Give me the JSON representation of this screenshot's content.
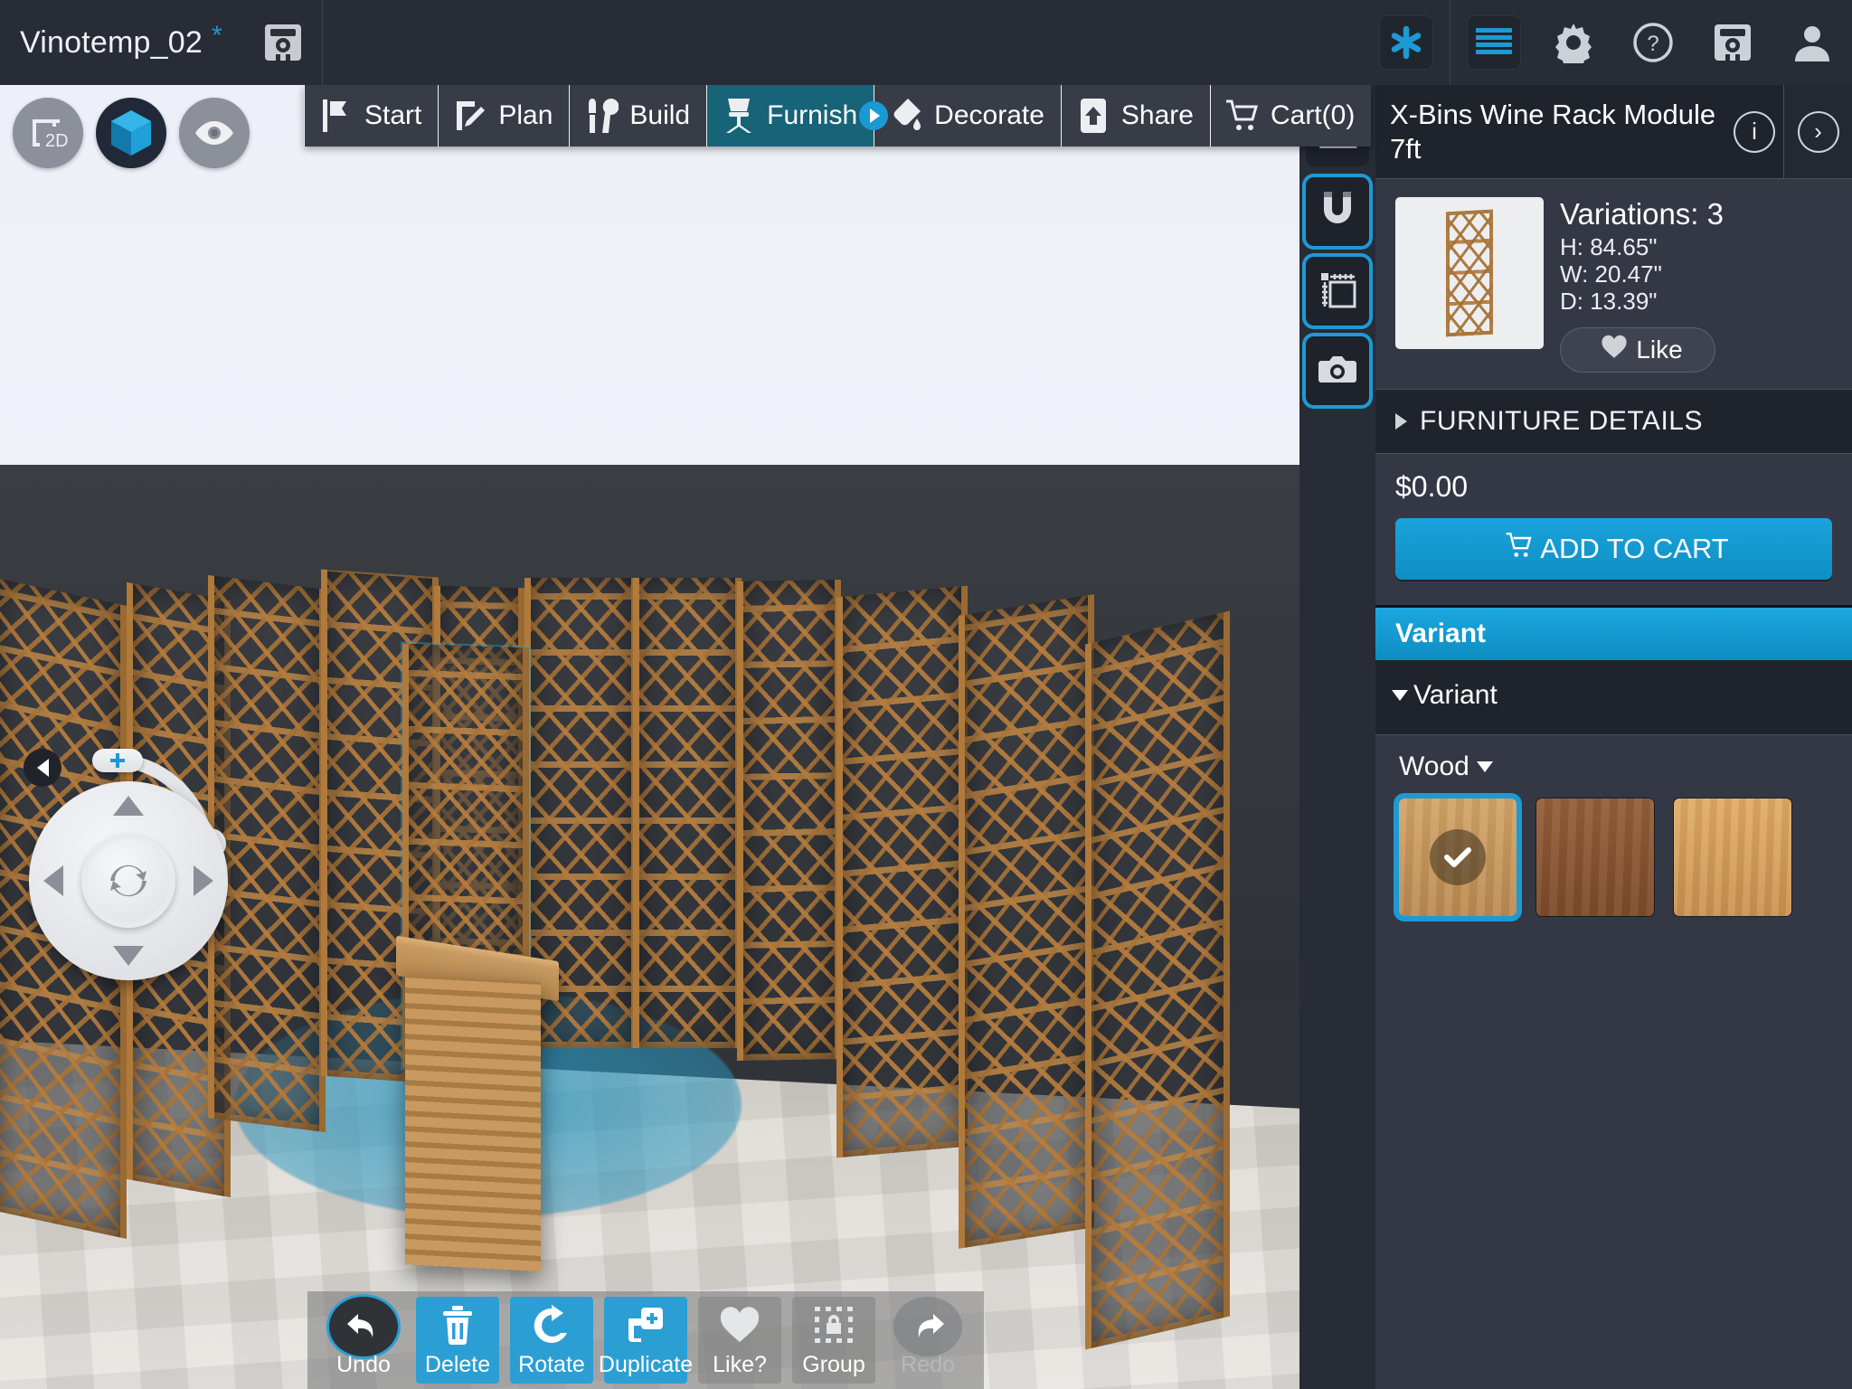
{
  "topbar": {
    "document_title": "Vinotemp_02",
    "unsaved_marker": "*",
    "save_icon": "save-disk-icon",
    "right_icons": [
      {
        "name": "asterisk-icon",
        "glyph": "asterisk"
      },
      {
        "name": "menu-icon",
        "glyph": "hamburger"
      },
      {
        "name": "gear-icon",
        "glyph": "gear"
      },
      {
        "name": "help-icon",
        "glyph": "question"
      },
      {
        "name": "save-project-icon",
        "glyph": "disk"
      },
      {
        "name": "user-account-icon",
        "glyph": "person"
      }
    ]
  },
  "viewmodes": [
    {
      "name": "view-2d-button",
      "label": "2D",
      "active": false
    },
    {
      "name": "view-3d-button",
      "label": "3D",
      "active": true
    },
    {
      "name": "view-eye-button",
      "label": "Eye",
      "active": false
    }
  ],
  "nav": {
    "tabs": [
      {
        "label": "Start",
        "icon": "flag-icon",
        "active": false
      },
      {
        "label": "Plan",
        "icon": "pencil-plan-icon",
        "active": false
      },
      {
        "label": "Build",
        "icon": "tools-icon",
        "active": false
      },
      {
        "label": "Furnish",
        "icon": "chair-icon",
        "active": true
      },
      {
        "label": "Decorate",
        "icon": "paint-icon",
        "active": false
      },
      {
        "label": "Share",
        "icon": "upload-icon",
        "active": false
      },
      {
        "label": "Cart(0)",
        "icon": "cart-icon",
        "active": false
      }
    ]
  },
  "righttools": [
    {
      "name": "angle-measure-tool",
      "icon": "angle-ruler-icon",
      "active": false
    },
    {
      "name": "snap-tool",
      "icon": "magnet-icon",
      "active": true
    },
    {
      "name": "dimension-tool",
      "icon": "ruler-box-icon",
      "active": true
    },
    {
      "name": "camera-tool",
      "icon": "camera-icon",
      "active": true
    }
  ],
  "panel": {
    "title": "X-Bins Wine Rack Module 7ft",
    "info_glyph": "i",
    "next_glyph": "›",
    "product": {
      "variations_label": "Variations: 3",
      "height": "H: 84.65\"",
      "width": "W: 20.47\"",
      "depth": "D: 13.39\"",
      "like_label": "Like"
    },
    "details_section_label": "FURNITURE DETAILS",
    "price": "$0.00",
    "add_to_cart_label": "ADD TO CART",
    "variant_bar_label": "Variant",
    "variant_sub_label": "Variant",
    "wood_label": "Wood",
    "swatches": [
      {
        "name": "wood-swatch-1",
        "color": "#c99a5e",
        "selected": true
      },
      {
        "name": "wood-swatch-2",
        "color": "#8b5431",
        "selected": false
      },
      {
        "name": "wood-swatch-3",
        "color": "#d9a35f",
        "selected": false
      }
    ]
  },
  "bottombar": [
    {
      "label": "Undo",
      "icon": "undo-arrow-icon",
      "style": "round-outlined",
      "enabled": true
    },
    {
      "label": "Delete",
      "icon": "trash-icon",
      "style": "blue",
      "enabled": true
    },
    {
      "label": "Rotate",
      "icon": "rotate-icon",
      "style": "blue",
      "enabled": true
    },
    {
      "label": "Duplicate",
      "icon": "duplicate-icon",
      "style": "blue",
      "enabled": true
    },
    {
      "label": "Like?",
      "icon": "heart-icon",
      "style": "grey",
      "enabled": true
    },
    {
      "label": "Group",
      "icon": "group-lock-icon",
      "style": "grey",
      "enabled": true
    },
    {
      "label": "Redo",
      "icon": "redo-arrow-icon",
      "style": "round-dim",
      "enabled": false
    }
  ],
  "joystick": {
    "collapse_icon": "collapse-left-icon",
    "rotate_icon": "rotate-center-icon",
    "zoom_in": "+",
    "zoom_out": "−"
  },
  "colors": {
    "accent": "#1d9ad4",
    "active_tab": "#176378",
    "panel_bg": "#343845",
    "chrome_bg": "#272c36"
  }
}
